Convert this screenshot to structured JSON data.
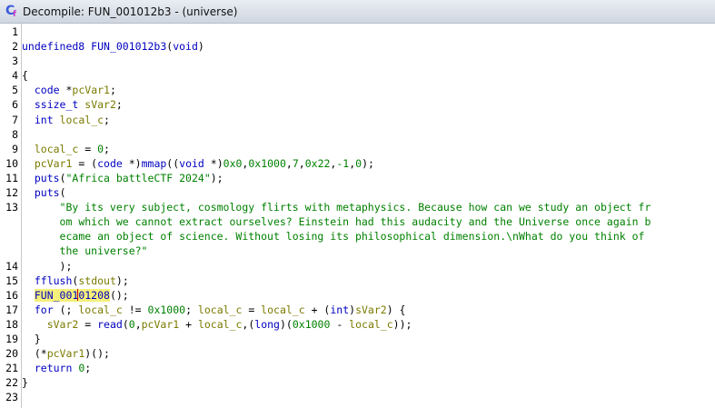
{
  "window": {
    "title": "Decompile: FUN_001012b3 - (universe)"
  },
  "colors": {
    "keyword": "#0000c0",
    "variable": "#7a7a00",
    "string": "#008000",
    "highlight": "#f4f07a"
  },
  "lines": [
    {
      "n": "1",
      "tokens": []
    },
    {
      "n": "2",
      "tokens": [
        {
          "t": "undefined8 ",
          "c": "kw"
        },
        {
          "t": "FUN_001012b3",
          "c": "fn"
        },
        {
          "t": "(",
          "c": ""
        },
        {
          "t": "void",
          "c": "kw"
        },
        {
          "t": ")",
          "c": ""
        }
      ]
    },
    {
      "n": "3",
      "tokens": []
    },
    {
      "n": "4",
      "tokens": [
        {
          "t": "{",
          "c": ""
        }
      ]
    },
    {
      "n": "5",
      "tokens": [
        {
          "t": "  ",
          "c": ""
        },
        {
          "t": "code",
          "c": "kw"
        },
        {
          "t": " *",
          "c": ""
        },
        {
          "t": "pcVar1",
          "c": "var"
        },
        {
          "t": ";",
          "c": ""
        }
      ]
    },
    {
      "n": "6",
      "tokens": [
        {
          "t": "  ",
          "c": ""
        },
        {
          "t": "ssize_t",
          "c": "kw"
        },
        {
          "t": " ",
          "c": ""
        },
        {
          "t": "sVar2",
          "c": "var"
        },
        {
          "t": ";",
          "c": ""
        }
      ]
    },
    {
      "n": "7",
      "tokens": [
        {
          "t": "  ",
          "c": ""
        },
        {
          "t": "int",
          "c": "kw"
        },
        {
          "t": " ",
          "c": ""
        },
        {
          "t": "local_c",
          "c": "var"
        },
        {
          "t": ";",
          "c": ""
        }
      ]
    },
    {
      "n": "8",
      "tokens": [
        {
          "t": "  ",
          "c": ""
        }
      ]
    },
    {
      "n": "9",
      "tokens": [
        {
          "t": "  ",
          "c": ""
        },
        {
          "t": "local_c",
          "c": "var"
        },
        {
          "t": " = ",
          "c": ""
        },
        {
          "t": "0",
          "c": "num"
        },
        {
          "t": ";",
          "c": ""
        }
      ]
    },
    {
      "n": "10",
      "tokens": [
        {
          "t": "  ",
          "c": ""
        },
        {
          "t": "pcVar1",
          "c": "var"
        },
        {
          "t": " = (",
          "c": ""
        },
        {
          "t": "code",
          "c": "kw"
        },
        {
          "t": " *)",
          "c": ""
        },
        {
          "t": "mmap",
          "c": "fn"
        },
        {
          "t": "((",
          "c": ""
        },
        {
          "t": "void",
          "c": "kw"
        },
        {
          "t": " *)",
          "c": ""
        },
        {
          "t": "0x0",
          "c": "num"
        },
        {
          "t": ",",
          "c": ""
        },
        {
          "t": "0x1000",
          "c": "num"
        },
        {
          "t": ",",
          "c": ""
        },
        {
          "t": "7",
          "c": "num"
        },
        {
          "t": ",",
          "c": ""
        },
        {
          "t": "0x22",
          "c": "num"
        },
        {
          "t": ",",
          "c": ""
        },
        {
          "t": "-1",
          "c": "num"
        },
        {
          "t": ",",
          "c": ""
        },
        {
          "t": "0",
          "c": "num"
        },
        {
          "t": ");",
          "c": ""
        }
      ]
    },
    {
      "n": "11",
      "tokens": [
        {
          "t": "  ",
          "c": ""
        },
        {
          "t": "puts",
          "c": "fn"
        },
        {
          "t": "(",
          "c": ""
        },
        {
          "t": "\"Africa battleCTF 2024\"",
          "c": "str"
        },
        {
          "t": ");",
          "c": ""
        }
      ]
    },
    {
      "n": "12",
      "tokens": [
        {
          "t": "  ",
          "c": ""
        },
        {
          "t": "puts",
          "c": "fn"
        },
        {
          "t": "(",
          "c": ""
        }
      ]
    },
    {
      "n": "13",
      "tokens": [
        {
          "t": "      ",
          "c": ""
        },
        {
          "t": "\"By its very subject, cosmology flirts with metaphysics. Because how can we study an object fr",
          "c": "str"
        }
      ]
    },
    {
      "n": "",
      "tokens": [
        {
          "t": "      ",
          "c": ""
        },
        {
          "t": "om which we cannot extract ourselves? Einstein had this audacity and the Universe once again b",
          "c": "str"
        }
      ]
    },
    {
      "n": "",
      "tokens": [
        {
          "t": "      ",
          "c": ""
        },
        {
          "t": "ecame an object of science. Without losing its philosophical dimension.\\nWhat do you think of",
          "c": "str"
        }
      ]
    },
    {
      "n": "",
      "tokens": [
        {
          "t": "      ",
          "c": ""
        },
        {
          "t": "the universe?\"",
          "c": "str"
        }
      ]
    },
    {
      "n": "14",
      "tokens": [
        {
          "t": "      ",
          "c": ""
        },
        {
          "t": ");",
          "c": ""
        }
      ]
    },
    {
      "n": "15",
      "tokens": [
        {
          "t": "  ",
          "c": ""
        },
        {
          "t": "fflush",
          "c": "fn"
        },
        {
          "t": "(",
          "c": ""
        },
        {
          "t": "stdout",
          "c": "var"
        },
        {
          "t": ");",
          "c": ""
        }
      ]
    },
    {
      "n": "16",
      "tokens": [
        {
          "t": "  ",
          "c": ""
        },
        {
          "t": "FUN_001",
          "c": "fn hl"
        },
        {
          "t": "|",
          "c": "caret"
        },
        {
          "t": "01208",
          "c": "fn hl"
        },
        {
          "t": "();",
          "c": ""
        }
      ]
    },
    {
      "n": "17",
      "tokens": [
        {
          "t": "  ",
          "c": ""
        },
        {
          "t": "for",
          "c": "kw"
        },
        {
          "t": " (; ",
          "c": ""
        },
        {
          "t": "local_c",
          "c": "var"
        },
        {
          "t": " != ",
          "c": ""
        },
        {
          "t": "0x1000",
          "c": "num"
        },
        {
          "t": "; ",
          "c": ""
        },
        {
          "t": "local_c",
          "c": "var"
        },
        {
          "t": " = ",
          "c": ""
        },
        {
          "t": "local_c",
          "c": "var"
        },
        {
          "t": " + (",
          "c": ""
        },
        {
          "t": "int",
          "c": "kw"
        },
        {
          "t": ")",
          "c": ""
        },
        {
          "t": "sVar2",
          "c": "var"
        },
        {
          "t": ") {",
          "c": ""
        }
      ]
    },
    {
      "n": "18",
      "tokens": [
        {
          "t": "    ",
          "c": ""
        },
        {
          "t": "sVar2",
          "c": "var"
        },
        {
          "t": " = ",
          "c": ""
        },
        {
          "t": "read",
          "c": "fn"
        },
        {
          "t": "(",
          "c": ""
        },
        {
          "t": "0",
          "c": "num"
        },
        {
          "t": ",",
          "c": ""
        },
        {
          "t": "pcVar1",
          "c": "var"
        },
        {
          "t": " + ",
          "c": ""
        },
        {
          "t": "local_c",
          "c": "var"
        },
        {
          "t": ",(",
          "c": ""
        },
        {
          "t": "long",
          "c": "kw"
        },
        {
          "t": ")(",
          "c": ""
        },
        {
          "t": "0x1000",
          "c": "num"
        },
        {
          "t": " - ",
          "c": ""
        },
        {
          "t": "local_c",
          "c": "var"
        },
        {
          "t": "));",
          "c": ""
        }
      ]
    },
    {
      "n": "19",
      "tokens": [
        {
          "t": "  }",
          "c": ""
        }
      ]
    },
    {
      "n": "20",
      "tokens": [
        {
          "t": "  (*",
          "c": ""
        },
        {
          "t": "pcVar1",
          "c": "var"
        },
        {
          "t": ")();",
          "c": ""
        }
      ]
    },
    {
      "n": "21",
      "tokens": [
        {
          "t": "  ",
          "c": ""
        },
        {
          "t": "return",
          "c": "kw"
        },
        {
          "t": " ",
          "c": ""
        },
        {
          "t": "0",
          "c": "num"
        },
        {
          "t": ";",
          "c": ""
        }
      ]
    },
    {
      "n": "22",
      "tokens": [
        {
          "t": "}",
          "c": ""
        }
      ]
    },
    {
      "n": "23",
      "tokens": []
    }
  ]
}
